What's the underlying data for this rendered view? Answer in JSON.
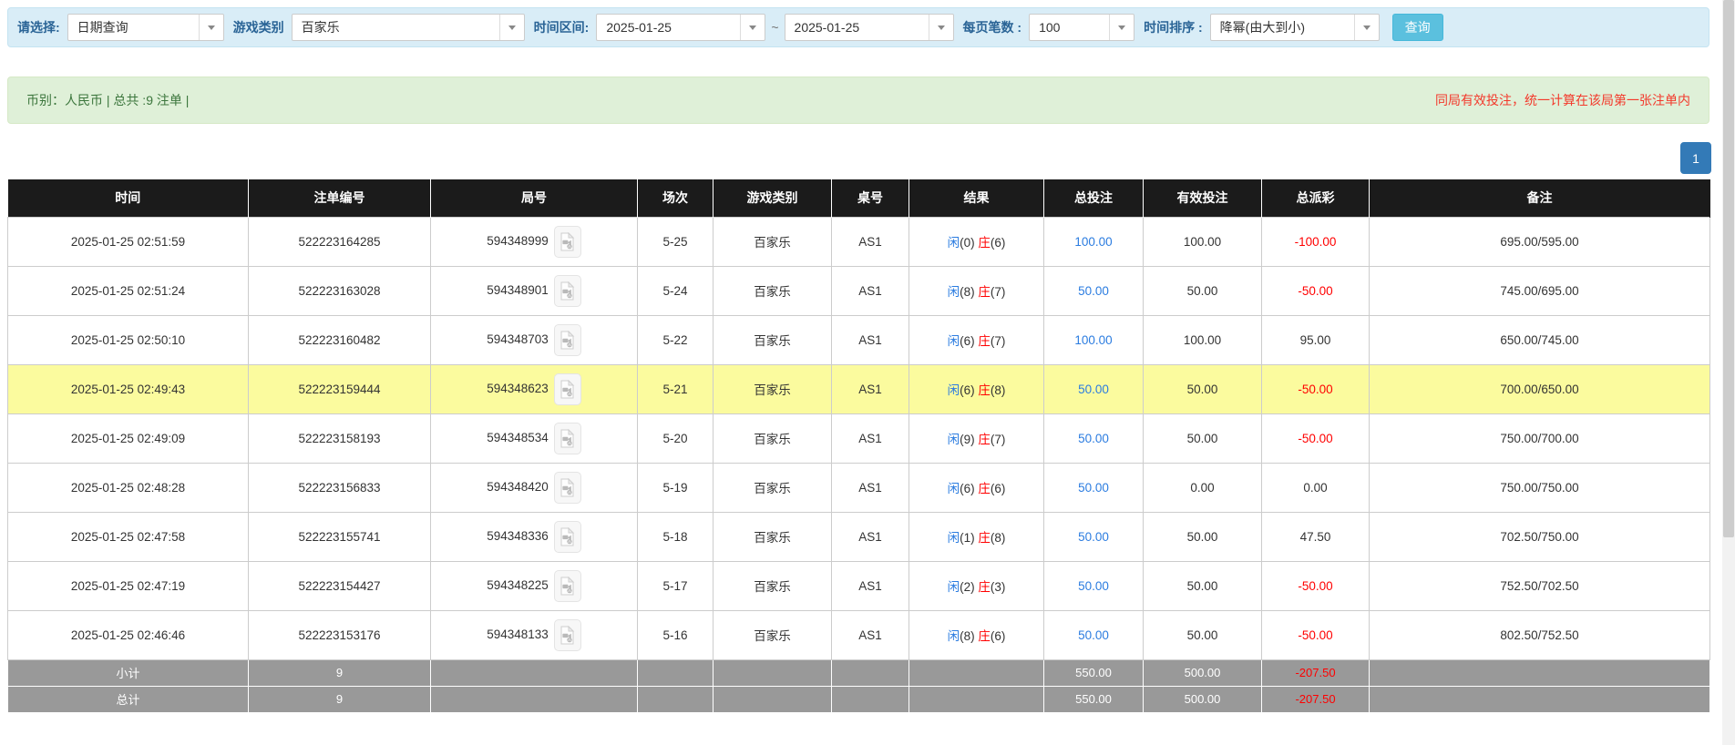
{
  "filters": {
    "select_label": "请选择:",
    "select_value": "日期查询",
    "game_label": "游戏类别",
    "game_value": "百家乐",
    "range_label": "时间区间:",
    "date_from": "2025-01-25",
    "range_sep": "~",
    "date_to": "2025-01-25",
    "per_page_label": "每页笔数 :",
    "per_page_value": "100",
    "sort_label": "时间排序 :",
    "sort_value": "降幂(由大到小)",
    "search_button": "查询"
  },
  "summary_bar": {
    "left_text": "币别：人民币 | 总共 :9 注单 |",
    "right_notice": "同局有效投注，统一计算在该局第一张注单内"
  },
  "pagination": {
    "current_page": "1"
  },
  "table": {
    "headers": [
      "时间",
      "注单编号",
      "局号",
      "场次",
      "游戏类别",
      "桌号",
      "结果",
      "总投注",
      "有效投注",
      "总派彩",
      "备注"
    ],
    "result_labels": {
      "player": "闲",
      "banker": "庄"
    },
    "rows": [
      {
        "time": "2025-01-25 02:51:59",
        "bet_no": "522223164285",
        "round_no": "594348999",
        "session": "5-25",
        "game": "百家乐",
        "table_no": "AS1",
        "player_pts": "0",
        "banker_pts": "6",
        "total_bet": "100.00",
        "valid_bet": "100.00",
        "payout": "-100.00",
        "note": "695.00/595.00",
        "highlighted": false
      },
      {
        "time": "2025-01-25 02:51:24",
        "bet_no": "522223163028",
        "round_no": "594348901",
        "session": "5-24",
        "game": "百家乐",
        "table_no": "AS1",
        "player_pts": "8",
        "banker_pts": "7",
        "total_bet": "50.00",
        "valid_bet": "50.00",
        "payout": "-50.00",
        "note": "745.00/695.00",
        "highlighted": false
      },
      {
        "time": "2025-01-25 02:50:10",
        "bet_no": "522223160482",
        "round_no": "594348703",
        "session": "5-22",
        "game": "百家乐",
        "table_no": "AS1",
        "player_pts": "6",
        "banker_pts": "7",
        "total_bet": "100.00",
        "valid_bet": "100.00",
        "payout": "95.00",
        "note": "650.00/745.00",
        "highlighted": false
      },
      {
        "time": "2025-01-25 02:49:43",
        "bet_no": "522223159444",
        "round_no": "594348623",
        "session": "5-21",
        "game": "百家乐",
        "table_no": "AS1",
        "player_pts": "6",
        "banker_pts": "8",
        "total_bet": "50.00",
        "valid_bet": "50.00",
        "payout": "-50.00",
        "note": "700.00/650.00",
        "highlighted": true
      },
      {
        "time": "2025-01-25 02:49:09",
        "bet_no": "522223158193",
        "round_no": "594348534",
        "session": "5-20",
        "game": "百家乐",
        "table_no": "AS1",
        "player_pts": "9",
        "banker_pts": "7",
        "total_bet": "50.00",
        "valid_bet": "50.00",
        "payout": "-50.00",
        "note": "750.00/700.00",
        "highlighted": false
      },
      {
        "time": "2025-01-25 02:48:28",
        "bet_no": "522223156833",
        "round_no": "594348420",
        "session": "5-19",
        "game": "百家乐",
        "table_no": "AS1",
        "player_pts": "6",
        "banker_pts": "6",
        "total_bet": "50.00",
        "valid_bet": "0.00",
        "payout": "0.00",
        "note": "750.00/750.00",
        "highlighted": false
      },
      {
        "time": "2025-01-25 02:47:58",
        "bet_no": "522223155741",
        "round_no": "594348336",
        "session": "5-18",
        "game": "百家乐",
        "table_no": "AS1",
        "player_pts": "1",
        "banker_pts": "8",
        "total_bet": "50.00",
        "valid_bet": "50.00",
        "payout": "47.50",
        "note": "702.50/750.00",
        "highlighted": false
      },
      {
        "time": "2025-01-25 02:47:19",
        "bet_no": "522223154427",
        "round_no": "594348225",
        "session": "5-17",
        "game": "百家乐",
        "table_no": "AS1",
        "player_pts": "2",
        "banker_pts": "3",
        "total_bet": "50.00",
        "valid_bet": "50.00",
        "payout": "-50.00",
        "note": "752.50/702.50",
        "highlighted": false
      },
      {
        "time": "2025-01-25 02:46:46",
        "bet_no": "522223153176",
        "round_no": "594348133",
        "session": "5-16",
        "game": "百家乐",
        "table_no": "AS1",
        "player_pts": "8",
        "banker_pts": "6",
        "total_bet": "50.00",
        "valid_bet": "50.00",
        "payout": "-50.00",
        "note": "802.50/752.50",
        "highlighted": false
      }
    ],
    "footer_rows": [
      {
        "label": "小计",
        "count": "9",
        "total_bet": "550.00",
        "valid_bet": "500.00",
        "payout": "-207.50"
      },
      {
        "label": "总计",
        "count": "9",
        "total_bet": "550.00",
        "valid_bet": "500.00",
        "payout": "-207.50"
      }
    ]
  },
  "colors": {
    "accent_blue": "#2b7ce0",
    "banker_red": "#ff0000",
    "notice_red": "#f3392b",
    "highlight_yellow": "#fbfb9e",
    "header_bg": "#1b1b1b",
    "footer_bg": "#999999",
    "search_button_cyan": "#5bc0de",
    "pagination_blue": "#337ab7",
    "filter_bar_bg": "#d9edf7",
    "summary_bar_bg": "#dff0d8"
  },
  "icons": {
    "video_icon": "video-file-icon",
    "caret_icon": "chevron-down-icon"
  }
}
